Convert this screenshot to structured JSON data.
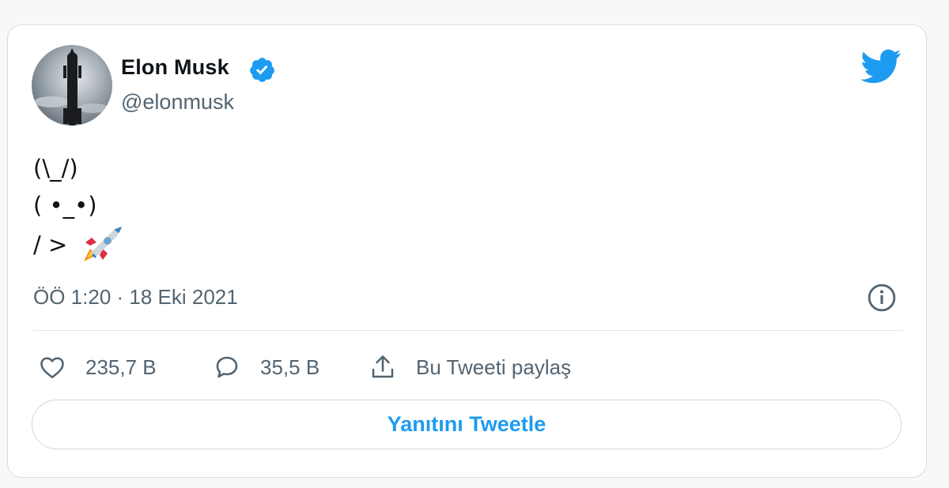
{
  "author": {
    "name": "Elon Musk",
    "handle": "@elonmusk",
    "verified": true
  },
  "tweet": {
    "lines": [
      "(\\_/)",
      "( •_•)",
      "/ >"
    ],
    "emoji": "rocket"
  },
  "timestamp": "ÖÖ 1:20 · 18 Eki 2021",
  "actions": {
    "likes": "235,7 B",
    "replies": "35,5 B",
    "share_label": "Bu Tweeti paylaş"
  },
  "reply_button_label": "Yanıtını Tweetle",
  "colors": {
    "accent": "#1d9bf0",
    "text": "#0f1419",
    "secondary": "#536471",
    "border": "#cfd9de"
  },
  "icons": [
    "verified-badge-icon",
    "twitter-bird-icon",
    "rocket-emoji-icon",
    "info-icon",
    "heart-icon",
    "reply-icon",
    "share-icon"
  ]
}
